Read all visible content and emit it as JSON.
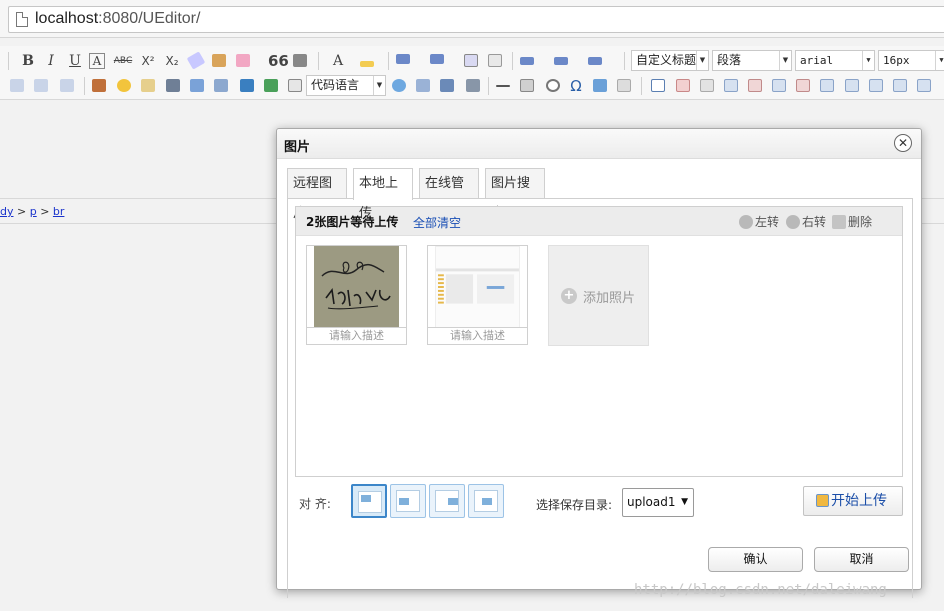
{
  "browser": {
    "url_host": "localhost",
    "url_rest": ":8080/UEditor/"
  },
  "toolbar": {
    "row1": [
      "B",
      "I",
      "U",
      "A",
      "ABC",
      "X²",
      "X₂",
      "66"
    ],
    "custom_heading": "自定义标题",
    "paragraph": "段落",
    "font_family": "arial",
    "font_size": "16px",
    "row2_code_lang": "代码语言",
    "omega": "Ω",
    "text_color_letter": "A"
  },
  "elempath": {
    "items": [
      "dy",
      "p",
      "br"
    ],
    "sep": " > "
  },
  "dialog": {
    "title": "图片",
    "close_symbol": "✕",
    "tabs": [
      "远程图片",
      "本地上传",
      "在线管理",
      "图片搜索"
    ],
    "active_tab": "本地上传",
    "queue": {
      "status": "2张图片等待上传",
      "clear_all": "全部清空",
      "rotate_left": "左转",
      "rotate_right": "右转",
      "delete": "删除"
    },
    "thumbs": [
      {
        "desc_placeholder": "请输入描述"
      },
      {
        "desc_placeholder": "请输入描述"
      }
    ],
    "add_photo": "添加照片",
    "add_plus": "+",
    "align_label": "对 齐:",
    "save_dir_label": "选择保存目录:",
    "save_dir_value": "upload1",
    "start_upload": "开始上传",
    "ok": "确认",
    "cancel": "取消"
  },
  "watermark": "http://blog.csdn.net/daleiwang"
}
